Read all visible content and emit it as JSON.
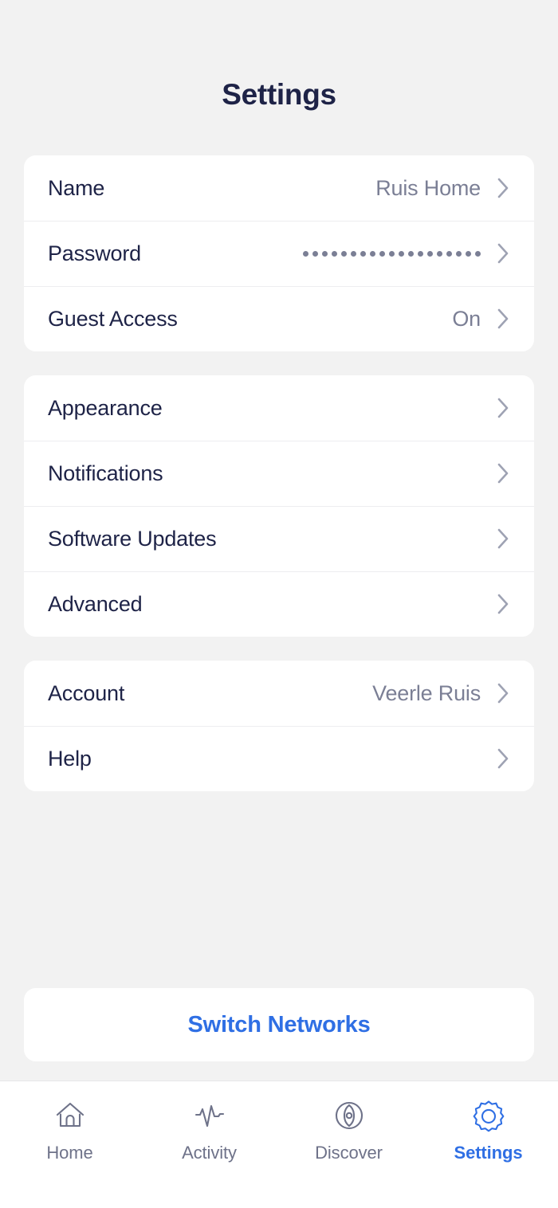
{
  "header": {
    "title": "Settings"
  },
  "colors": {
    "background": "#f2f2f2",
    "card": "#ffffff",
    "label": "#1e2347",
    "value": "#7b7f95",
    "chevron": "#9ea2b3",
    "accent": "#2f6fe4",
    "tab_inactive": "#6e7289",
    "divider": "#ededf0"
  },
  "groups": [
    {
      "rows": [
        {
          "label": "Name",
          "value": "Ruis Home",
          "type": "text",
          "chevron": "chevron-right-icon"
        },
        {
          "label": "Password",
          "value": "•••••••••••••••••••",
          "type": "password",
          "dots": 19,
          "chevron": "chevron-right-icon"
        },
        {
          "label": "Guest Access",
          "value": "On",
          "type": "text",
          "chevron": "chevron-right-icon"
        }
      ]
    },
    {
      "rows": [
        {
          "label": "Appearance",
          "value": "",
          "type": "text",
          "chevron": "chevron-right-icon"
        },
        {
          "label": "Notifications",
          "value": "",
          "type": "text",
          "chevron": "chevron-right-icon"
        },
        {
          "label": "Software Updates",
          "value": "",
          "type": "text",
          "chevron": "chevron-right-icon"
        },
        {
          "label": "Advanced",
          "value": "",
          "type": "text",
          "chevron": "chevron-right-icon"
        }
      ]
    },
    {
      "rows": [
        {
          "label": "Account",
          "value": "Veerle Ruis",
          "type": "text",
          "chevron": "chevron-right-icon"
        },
        {
          "label": "Help",
          "value": "",
          "type": "text",
          "chevron": "chevron-right-icon"
        }
      ]
    }
  ],
  "switch_networks": {
    "label": "Switch Networks"
  },
  "tabbar": {
    "items": [
      {
        "label": "Home",
        "icon": "home-icon",
        "active": false
      },
      {
        "label": "Activity",
        "icon": "activity-icon",
        "active": false
      },
      {
        "label": "Discover",
        "icon": "compass-icon",
        "active": false
      },
      {
        "label": "Settings",
        "icon": "gear-icon",
        "active": true
      }
    ]
  }
}
